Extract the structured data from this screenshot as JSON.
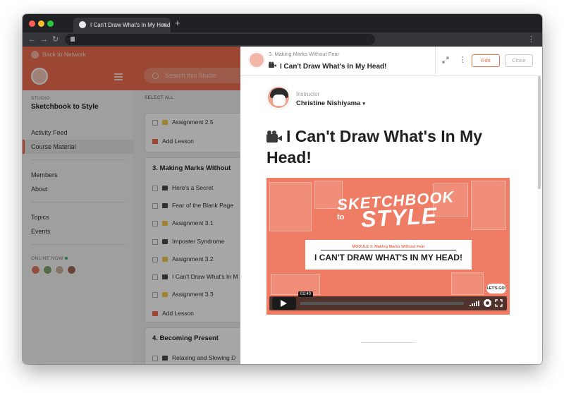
{
  "browser": {
    "tab_title": "I Can't Draw What's In My Head!",
    "tab_close": "×",
    "new_tab": "+",
    "nav_back": "←",
    "nav_forward": "→",
    "nav_reload": "↻",
    "menu": "⋮",
    "colors": {
      "frame": "#202124",
      "toolbar": "#35363a"
    }
  },
  "sidebar": {
    "back_label": "Back to Network",
    "studio_label": "STUDIO",
    "studio_name": "Sketchbook to Style",
    "items": [
      {
        "label": "Activity Feed"
      },
      {
        "label": "Course Material"
      },
      {
        "label": "Members"
      },
      {
        "label": "About"
      },
      {
        "label": "Topics"
      },
      {
        "label": "Events"
      }
    ],
    "online_label": "ONLINE NOW",
    "active_color": "#ee6e50"
  },
  "main": {
    "search_placeholder": "Search this Studio",
    "select_all": "SELECT ALL",
    "card1_rows": [
      {
        "label": "Assignment 2.5",
        "icon": "folder-icon"
      },
      {
        "label": "Add Lesson",
        "icon": "plus-icon"
      }
    ],
    "section3_title": "3. Making Marks Without",
    "section3_rows": [
      {
        "label": "Here's a Secret",
        "icon": "video-camera-icon"
      },
      {
        "label": "Fear of the Blank Page",
        "icon": "video-camera-icon"
      },
      {
        "label": "Assignment 3.1",
        "icon": "folder-icon"
      },
      {
        "label": "Imposter Syndrome",
        "icon": "video-camera-icon"
      },
      {
        "label": "Assignment 3.2",
        "icon": "folder-icon"
      },
      {
        "label": "I Can't Draw What's In M",
        "icon": "video-camera-icon"
      },
      {
        "label": "Assignment 3.3",
        "icon": "folder-icon"
      },
      {
        "label": "Add Lesson",
        "icon": "plus-icon"
      }
    ],
    "section4_title": "4. Becoming Present",
    "section4_rows": [
      {
        "label": "Relaxing and Slowing D",
        "icon": "video-camera-icon"
      }
    ]
  },
  "panel": {
    "breadcrumb": "3. Making Marks Without Fear",
    "title": "I Can't Draw What's In My Head!",
    "edit_label": "Edit",
    "close_label": "Close",
    "kebab": "⋮",
    "instructor_label": "Instructor",
    "instructor_name": "Christine Nishiyama",
    "caret": "▾",
    "lesson_title": "I Can't Draw What's In My Head!",
    "video": {
      "brand_top": "SKETCHBOOK",
      "brand_mid": "to",
      "brand_bottom": "STYLE",
      "module_line": "MODULE 3: Making Marks Without Fear",
      "headline": "I CAN'T DRAW WHAT'S IN MY HEAD!",
      "lets_go": "LET'S GO!",
      "timecode": "01:40",
      "progress": 0.0
    },
    "accent": "#ee6e50"
  }
}
